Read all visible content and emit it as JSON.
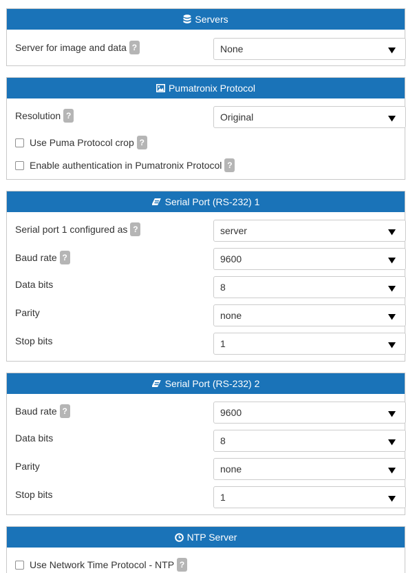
{
  "colors": {
    "header_bg": "#1a73b8",
    "header_text": "#ffffff",
    "help_badge": "#b5b5b5",
    "border": "#c8c8c8"
  },
  "help_glyph": "?",
  "select_arrow": "▼",
  "servers": {
    "title": "Servers",
    "icon": "database-icon",
    "server_label": "Server for image and data",
    "server_value": "None"
  },
  "pumatronix": {
    "title": "Pumatronix Protocol",
    "icon": "image-icon",
    "resolution_label": "Resolution",
    "resolution_value": "Original",
    "crop_label": "Use Puma Protocol crop",
    "auth_label": "Enable authentication in Pumatronix Protocol"
  },
  "serial1": {
    "title": "Serial Port (RS-232) 1",
    "icon": "plug-icon",
    "configured_label": "Serial port 1 configured as",
    "configured_value": "server",
    "baud_label": "Baud rate",
    "baud_value": "9600",
    "databits_label": "Data bits",
    "databits_value": "8",
    "parity_label": "Parity",
    "parity_value": "none",
    "stopbits_label": "Stop bits",
    "stopbits_value": "1"
  },
  "serial2": {
    "title": "Serial Port (RS-232) 2",
    "icon": "plug-icon",
    "baud_label": "Baud rate",
    "baud_value": "9600",
    "databits_label": "Data bits",
    "databits_value": "8",
    "parity_label": "Parity",
    "parity_value": "none",
    "stopbits_label": "Stop bits",
    "stopbits_value": "1"
  },
  "ntp": {
    "title": "NTP Server",
    "icon": "clock-icon",
    "use_ntp_label": "Use Network Time Protocol - NTP"
  }
}
